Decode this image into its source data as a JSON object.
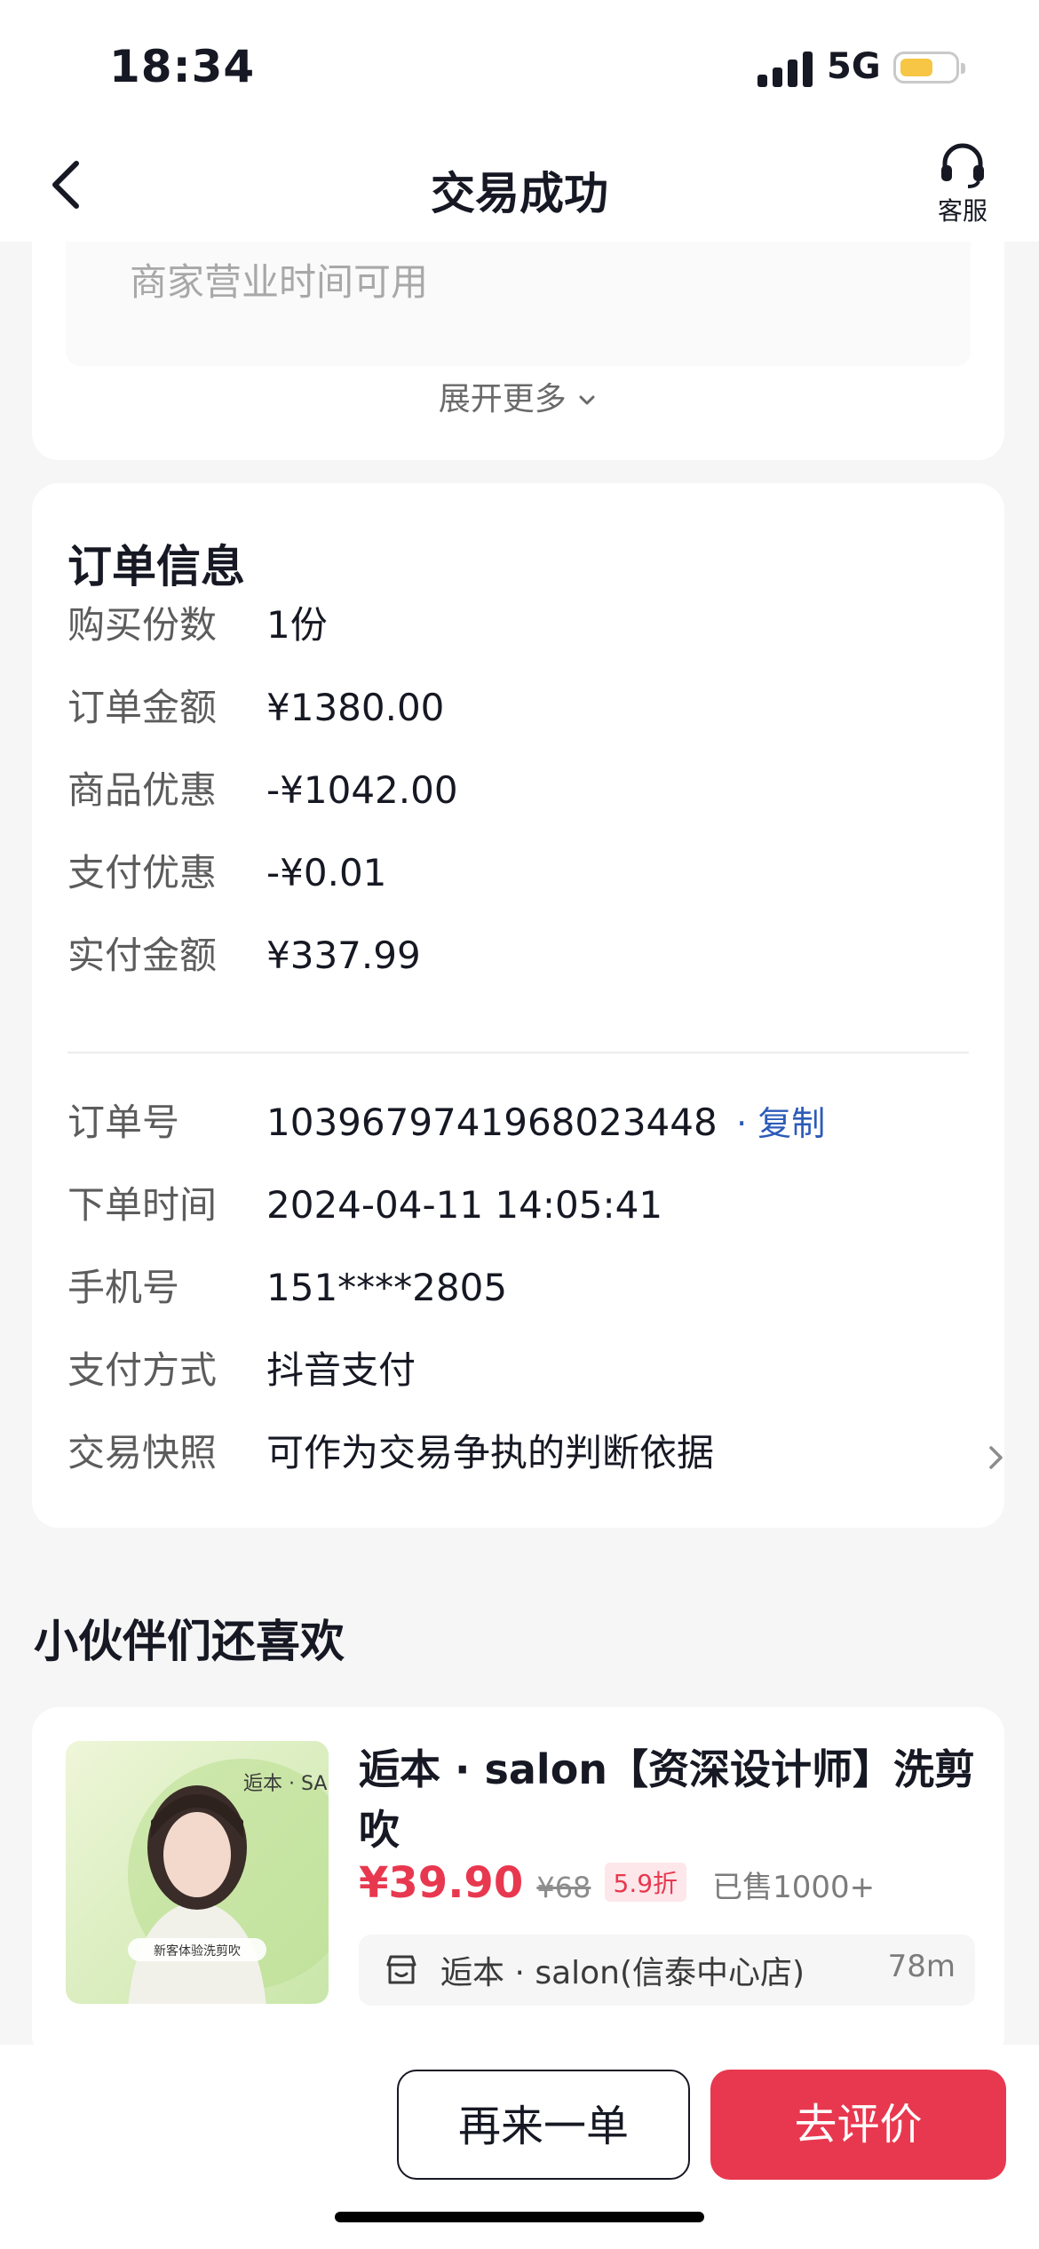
{
  "status_bar": {
    "time": "18:34",
    "network": "5G"
  },
  "nav": {
    "title": "交易成功",
    "service_label": "客服"
  },
  "top_card": {
    "faded_text": "商家营业时间可用",
    "expand_label": "展开更多"
  },
  "order": {
    "title": "订单信息",
    "rows": [
      {
        "label": "购买份数",
        "value": "1份"
      },
      {
        "label": "订单金额",
        "value": "¥1380.00"
      },
      {
        "label": "商品优惠",
        "value": "-¥1042.00"
      },
      {
        "label": "支付优惠",
        "value": "-¥0.01"
      },
      {
        "label": "实付金额",
        "value": "¥337.99"
      }
    ],
    "order_no_label": "订单号",
    "order_no": "1039679741968023448",
    "copy_label": "· 复制",
    "detail_rows": [
      {
        "label": "下单时间",
        "value": "2024-04-11 14:05:41"
      },
      {
        "label": "手机号",
        "value": "151****2805"
      },
      {
        "label": "支付方式",
        "value": "抖音支付"
      },
      {
        "label": "交易快照",
        "value": "可作为交易争执的判断依据"
      }
    ]
  },
  "recommend": {
    "title": "小伙伴们还喜欢",
    "product": {
      "name": "逅本 · salon【资深设计师】洗剪吹",
      "image_caption": "新客体验洗剪吹",
      "image_brand": "逅本 · SA",
      "price": "¥39.90",
      "old_price": "¥68",
      "discount": "5.9折",
      "sold": "已售1000+",
      "shop": "逅本 · salon(信泰中心店)",
      "distance": "78m"
    }
  },
  "actions": {
    "again_label": "再来一单",
    "review_label": "去评价"
  },
  "colors": {
    "accent": "#e8384f",
    "link": "#2c5bb8"
  }
}
